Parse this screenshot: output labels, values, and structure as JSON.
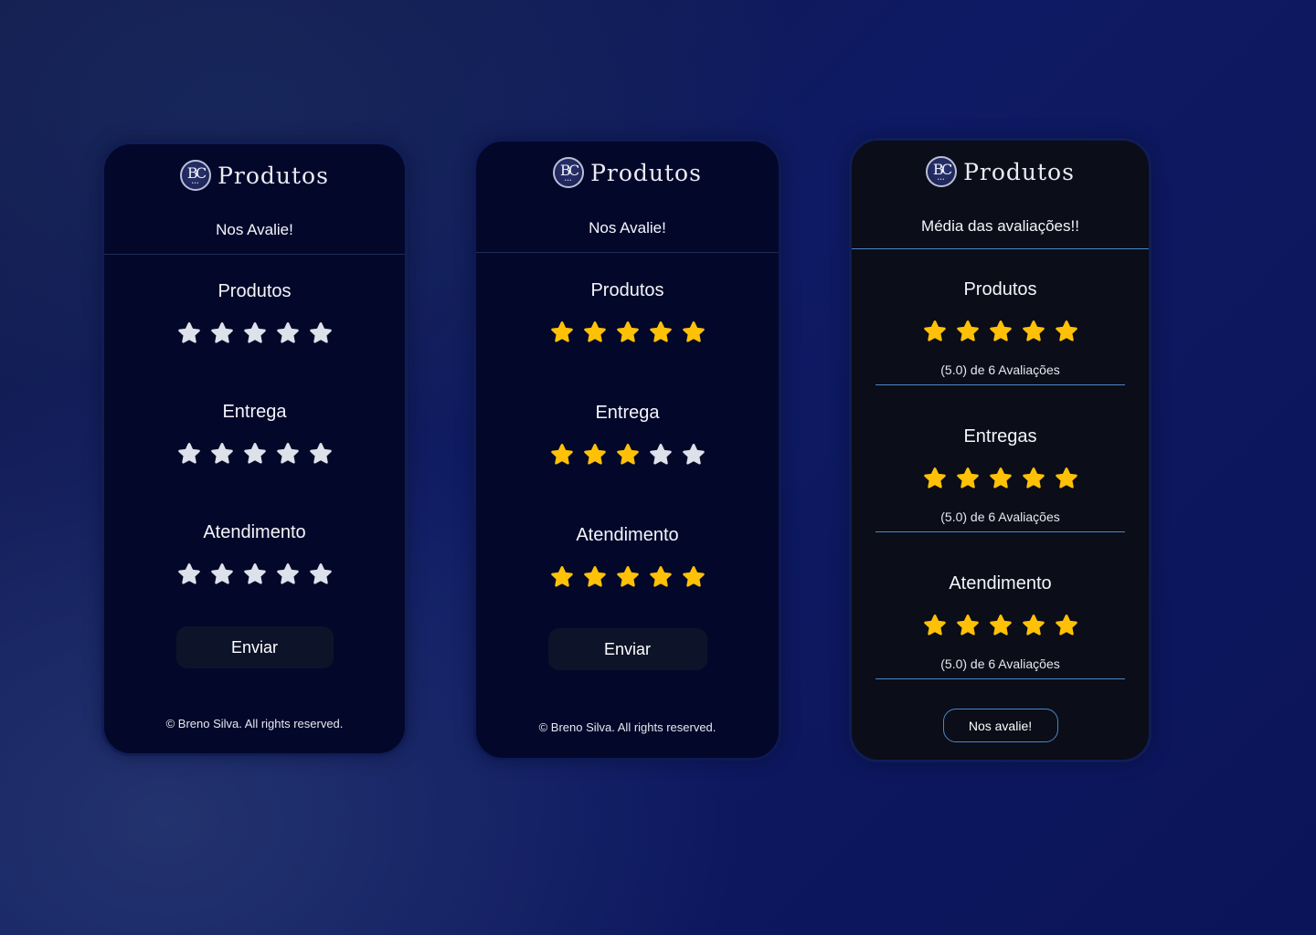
{
  "brand": {
    "name": "Produtos",
    "logo_text": "BC",
    "logo_dots": "•••"
  },
  "icons": {
    "star": "star-icon"
  },
  "colors": {
    "star_on": "#ffc107",
    "star_off": "#dde1ea",
    "accent_line": "#4b86c8"
  },
  "cards": [
    {
      "subtitle": "Nos Avalie!",
      "sections": [
        {
          "title": "Produtos",
          "rating": 0,
          "max": 5
        },
        {
          "title": "Entrega",
          "rating": 0,
          "max": 5
        },
        {
          "title": "Atendimento",
          "rating": 0,
          "max": 5
        }
      ],
      "button": "Enviar",
      "footer": "© Breno Silva. All rights reserved."
    },
    {
      "subtitle": "Nos Avalie!",
      "sections": [
        {
          "title": "Produtos",
          "rating": 5,
          "max": 5
        },
        {
          "title": "Entrega",
          "rating": 3,
          "max": 5
        },
        {
          "title": "Atendimento",
          "rating": 5,
          "max": 5
        }
      ],
      "button": "Enviar",
      "footer": "© Breno Silva. All rights reserved."
    },
    {
      "subtitle": "Média das avaliações!!",
      "sections": [
        {
          "title": "Produtos",
          "rating": 5,
          "max": 5,
          "summary": "(5.0) de 6 Avaliações"
        },
        {
          "title": "Entregas",
          "rating": 5,
          "max": 5,
          "summary": "(5.0) de 6 Avaliações"
        },
        {
          "title": "Atendimento",
          "rating": 5,
          "max": 5,
          "summary": "(5.0) de 6 Avaliações"
        }
      ],
      "button": "Nos avalie!"
    }
  ]
}
